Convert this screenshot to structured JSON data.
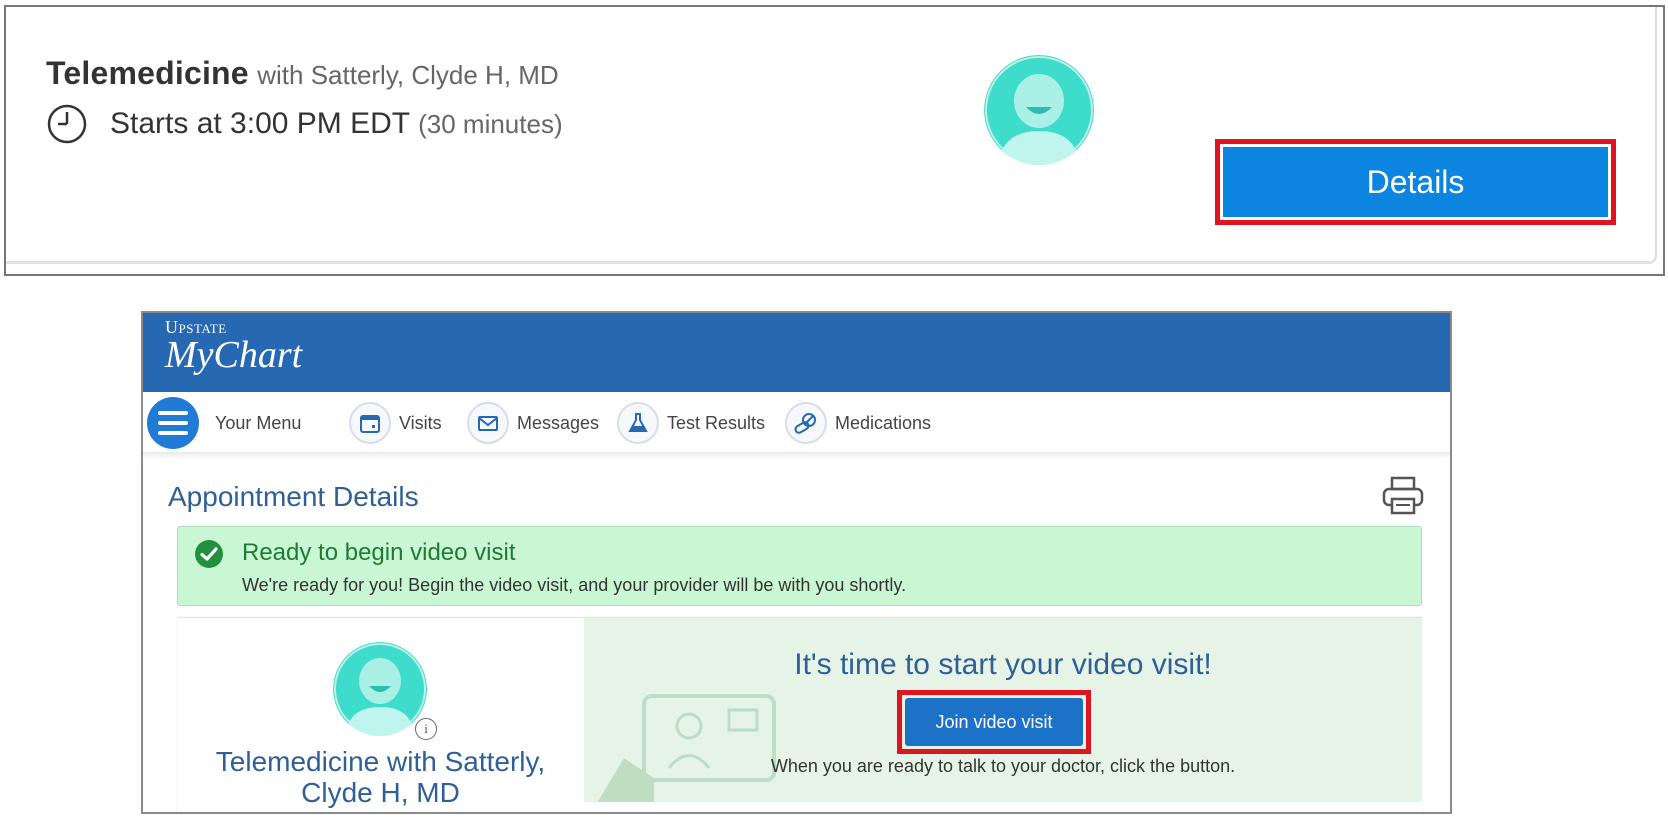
{
  "appointment_card": {
    "type": "Telemedicine",
    "provider": "with Satterly, Clyde H, MD",
    "start_time": "Starts at 3:00 PM EDT",
    "duration": "(30 minutes)",
    "details_label": "Details",
    "highlight_color": "#e0141e",
    "button_color": "#0c85e0"
  },
  "mychart": {
    "logo": {
      "top": "Upstate",
      "main": "MyChart"
    },
    "header_color": "#2768b3",
    "nav": [
      {
        "label": "Your Menu",
        "icon": "hamburger-menu-icon"
      },
      {
        "label": "Visits",
        "icon": "calendar-icon"
      },
      {
        "label": "Messages",
        "icon": "envelope-icon"
      },
      {
        "label": "Test Results",
        "icon": "flask-icon"
      },
      {
        "label": "Medications",
        "icon": "pills-icon"
      }
    ],
    "page_title": "Appointment Details",
    "alert": {
      "title": "Ready to begin video visit",
      "text": "We're ready for you! Begin the video visit, and your provider will be with you shortly.",
      "color": "#c9f7d4"
    },
    "visit": {
      "name": "Telemedicine with Satterly, Clyde H, MD",
      "heading": "It's time to start your video visit!",
      "join_label": "Join video visit",
      "hint": "When you are ready to talk to your doctor, click the button."
    }
  }
}
